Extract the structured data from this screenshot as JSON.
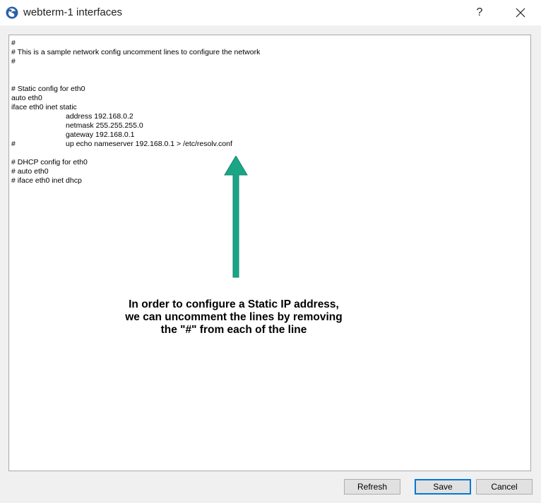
{
  "window": {
    "title": "webterm-1 interfaces",
    "help_label": "?"
  },
  "editor": {
    "lines": [
      {
        "prefix": "",
        "text": "#"
      },
      {
        "prefix": "",
        "text": "# This is a sample network config uncomment lines to configure the network"
      },
      {
        "prefix": "",
        "text": "#"
      },
      {
        "prefix": "",
        "text": ""
      },
      {
        "prefix": "",
        "text": ""
      },
      {
        "prefix": "",
        "text": "# Static config for eth0"
      },
      {
        "prefix": "",
        "text": "auto eth0"
      },
      {
        "prefix": "",
        "text": "iface eth0 inet static"
      },
      {
        "prefix": "",
        "text": "address 192.168.0.2",
        "indent": true
      },
      {
        "prefix": "",
        "text": "netmask 255.255.255.0",
        "indent": true
      },
      {
        "prefix": "",
        "text": "gateway 192.168.0.1",
        "indent": true
      },
      {
        "prefix": "#",
        "text": "up echo nameserver 192.168.0.1 > /etc/resolv.conf",
        "indent": true
      },
      {
        "prefix": "",
        "text": ""
      },
      {
        "prefix": "",
        "text": "# DHCP config for eth0"
      },
      {
        "prefix": "",
        "text": "# auto eth0"
      },
      {
        "prefix": "",
        "text": "# iface eth0 inet dhcp"
      }
    ]
  },
  "annotation": {
    "lines": [
      "In order to configure a Static IP address,",
      "we can uncomment the lines by removing",
      "the \"#\" from each of the line"
    ],
    "arrow_color": "#1aa587"
  },
  "buttons": {
    "refresh": "Refresh",
    "save": "Save",
    "cancel": "Cancel"
  },
  "icons": {
    "app": "gns3-app-icon",
    "close": "close-icon",
    "arrow": "up-arrow-icon"
  }
}
